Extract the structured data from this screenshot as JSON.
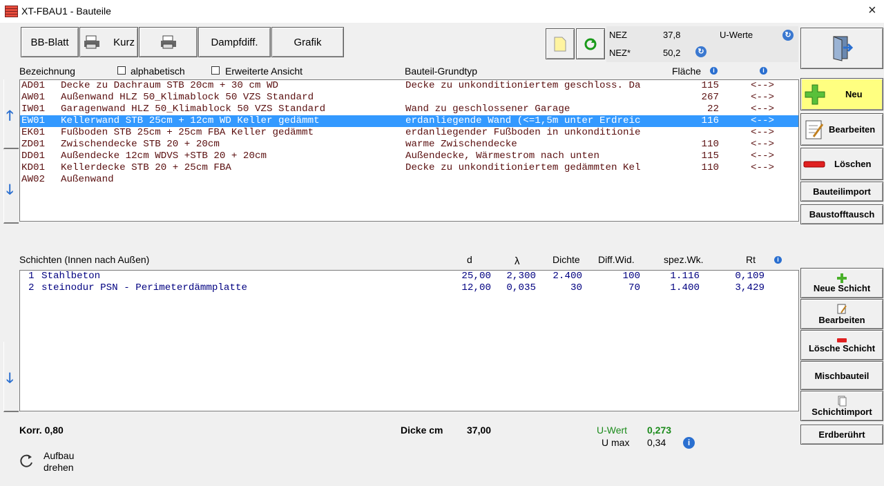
{
  "window": {
    "title": "XT-FBAU1 - Bauteile",
    "close_glyph": "×"
  },
  "toolbar": {
    "bb_blatt": "BB-Blatt",
    "kurz": "Kurz",
    "dampfdiff": "Dampfdiff.",
    "grafik": "Grafik"
  },
  "energy": {
    "nez_label": "NEZ",
    "nez_value": "37,8",
    "nez_star_label": "NEZ*",
    "nez_star_value": "50,2",
    "u_werte": "U-Werte"
  },
  "list_header": {
    "bezeichnung": "Bezeichnung",
    "alphabetisch": "alphabetisch",
    "erweiterte": "Erweiterte Ansicht",
    "grundtyp": "Bauteil-Grundtyp",
    "flaeche": "Fläche"
  },
  "components": [
    {
      "code": "AD01",
      "name": "Decke zu Dachraum STB 20cm + 30 cm WD",
      "type": "Decke zu unkonditioniertem geschloss. Da",
      "area": "115",
      "link": "<-->"
    },
    {
      "code": "AW01",
      "name": "Außenwand HLZ 50_Klimablock 50 VZS Standard",
      "type": "",
      "area": "267",
      "link": "<-->"
    },
    {
      "code": "IW01",
      "name": "Garagenwand HLZ 50_Klimablock 50 VZS Standard",
      "type": "Wand zu geschlossener Garage",
      "area": "22",
      "link": "<-->"
    },
    {
      "code": "EW01",
      "name": "Kellerwand STB 25cm + 12cm WD Keller gedämmt",
      "type": "erdanliegende Wand (<=1,5m unter Erdreic",
      "area": "116",
      "link": "<-->"
    },
    {
      "code": "EK01",
      "name": "Fußboden STB 25cm + 25cm FBA Keller gedämmt",
      "type": "erdanliegender Fußboden in unkonditionie",
      "area": "",
      "link": "<-->"
    },
    {
      "code": "ZD01",
      "name": "Zwischendecke STB 20 + 20cm",
      "type": "warme Zwischendecke",
      "area": "110",
      "link": "<-->"
    },
    {
      "code": "DD01",
      "name": "Außendecke 12cm WDVS +STB 20 + 20cm",
      "type": "Außendecke, Wärmestrom nach unten",
      "area": "115",
      "link": "<-->"
    },
    {
      "code": "KD01",
      "name": "Kellerdecke STB 20 + 25cm FBA",
      "type": "Decke zu unkonditioniertem gedämmten Kel",
      "area": "110",
      "link": "<-->"
    },
    {
      "code": "AW02",
      "name": "Außenwand",
      "type": "",
      "area": "",
      "link": ""
    }
  ],
  "right_buttons": {
    "neu": "Neu",
    "bearbeiten": "Bearbeiten",
    "loeschen": "Löschen",
    "bauteilimport": "Bauteilimport",
    "baustofftausch": "Baustofftausch"
  },
  "layer_header": {
    "schichten": "Schichten (Innen nach Außen)",
    "d": "d",
    "lambda": "λ",
    "dichte": "Dichte",
    "diff": "Diff.Wid.",
    "spez": "spez.Wk.",
    "rt": "Rt"
  },
  "layers": [
    {
      "nr": "1",
      "name": "Stahlbeton",
      "d": "25,00",
      "lambda": "2,300",
      "dichte": "2.400",
      "diff": "100",
      "spez": "1.116",
      "rt": "0,109"
    },
    {
      "nr": "2",
      "name": "steinodur PSN - Perimeterdämmplatte",
      "d": "12,00",
      "lambda": "0,035",
      "dichte": "30",
      "diff": "70",
      "spez": "1.400",
      "rt": "3,429"
    }
  ],
  "layer_buttons": {
    "neue_schicht": "Neue Schicht",
    "bearbeiten": "Bearbeiten",
    "loesche": "Lösche Schicht",
    "mischbauteil": "Mischbauteil",
    "schichtimport": "Schichtimport",
    "erdberuehrt": "Erdberührt"
  },
  "footer": {
    "korr": "Korr. 0,80",
    "dicke_label": "Dicke cm",
    "dicke_value": "37,00",
    "uwert_label": "U-Wert",
    "uwert_value": "0,273",
    "umax_label": "U max",
    "umax_value": "0,34",
    "aufbau1": "Aufbau",
    "aufbau2": "drehen"
  },
  "colors": {
    "selection": "#3399ff",
    "neu_button": "#ffff80",
    "list_text": "#5a0f0f",
    "layer_text": "#000080",
    "uwert": "#1a8a1a"
  }
}
